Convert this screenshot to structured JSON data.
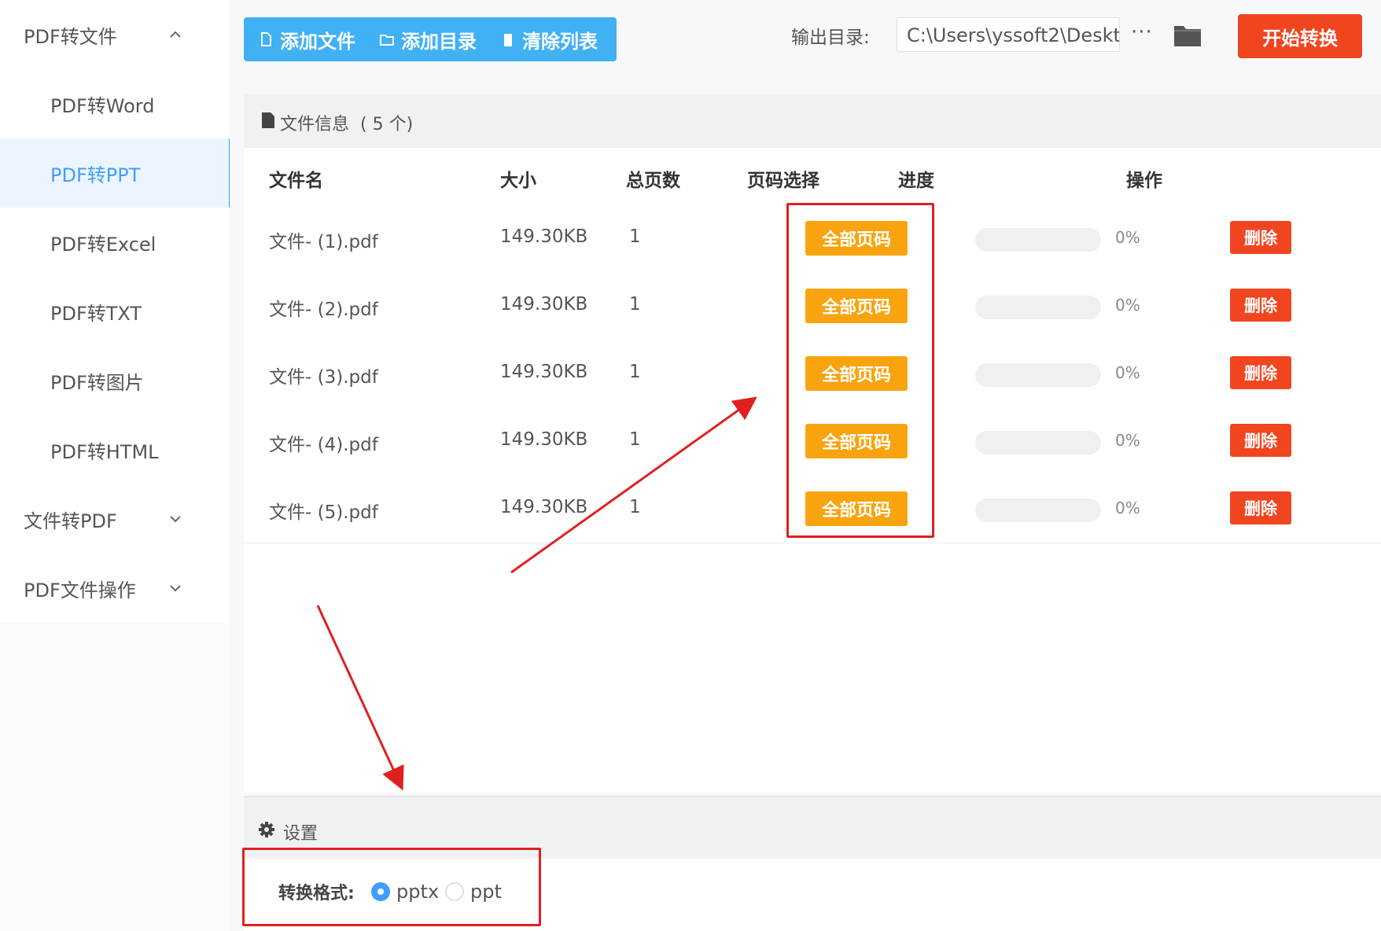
{
  "sidebar": {
    "groups": [
      {
        "label": "PDF转文件",
        "expanded": true,
        "items": [
          {
            "label": "PDF转Word",
            "active": false
          },
          {
            "label": "PDF转PPT",
            "active": true
          },
          {
            "label": "PDF转Excel",
            "active": false
          },
          {
            "label": "PDF转TXT",
            "active": false
          },
          {
            "label": "PDF转图片",
            "active": false
          },
          {
            "label": "PDF转HTML",
            "active": false
          }
        ]
      },
      {
        "label": "文件转PDF",
        "expanded": false
      },
      {
        "label": "PDF文件操作",
        "expanded": false
      }
    ]
  },
  "toolbar": {
    "add_file": "添加文件",
    "add_dir": "添加目录",
    "clear_list": "清除列表",
    "output_label": "输出目录:",
    "output_path": "C:\\Users\\yssoft2\\Deskt",
    "more": "···",
    "start": "开始转换"
  },
  "file_panel": {
    "title": "文件信息",
    "count": "( 5 个)",
    "columns": [
      "文件名",
      "大小",
      "总页数",
      "页码选择",
      "进度",
      "操作"
    ],
    "rows": [
      {
        "name": "文件- (1).pdf",
        "size": "149.30KB",
        "pages": "1",
        "page_select": "全部页码",
        "progress": "0%",
        "progress_value": 0,
        "action": "删除"
      },
      {
        "name": "文件- (2).pdf",
        "size": "149.30KB",
        "pages": "1",
        "page_select": "全部页码",
        "progress": "0%",
        "progress_value": 0,
        "action": "删除"
      },
      {
        "name": "文件- (3).pdf",
        "size": "149.30KB",
        "pages": "1",
        "page_select": "全部页码",
        "progress": "0%",
        "progress_value": 0,
        "action": "删除"
      },
      {
        "name": "文件- (4).pdf",
        "size": "149.30KB",
        "pages": "1",
        "page_select": "全部页码",
        "progress": "0%",
        "progress_value": 0,
        "action": "删除"
      },
      {
        "name": "文件- (5).pdf",
        "size": "149.30KB",
        "pages": "1",
        "page_select": "全部页码",
        "progress": "0%",
        "progress_value": 0,
        "action": "删除"
      }
    ]
  },
  "settings": {
    "title": "设置",
    "format_label": "转换格式:",
    "options": [
      {
        "label": "pptx",
        "checked": true
      },
      {
        "label": "ppt",
        "checked": false
      }
    ]
  },
  "colors": {
    "accent": "#409eff",
    "toolbar_blue": "#40b1f5",
    "start_red": "#f0451f",
    "page_orange": "#f9a40e",
    "annotation_red": "#e02020"
  }
}
